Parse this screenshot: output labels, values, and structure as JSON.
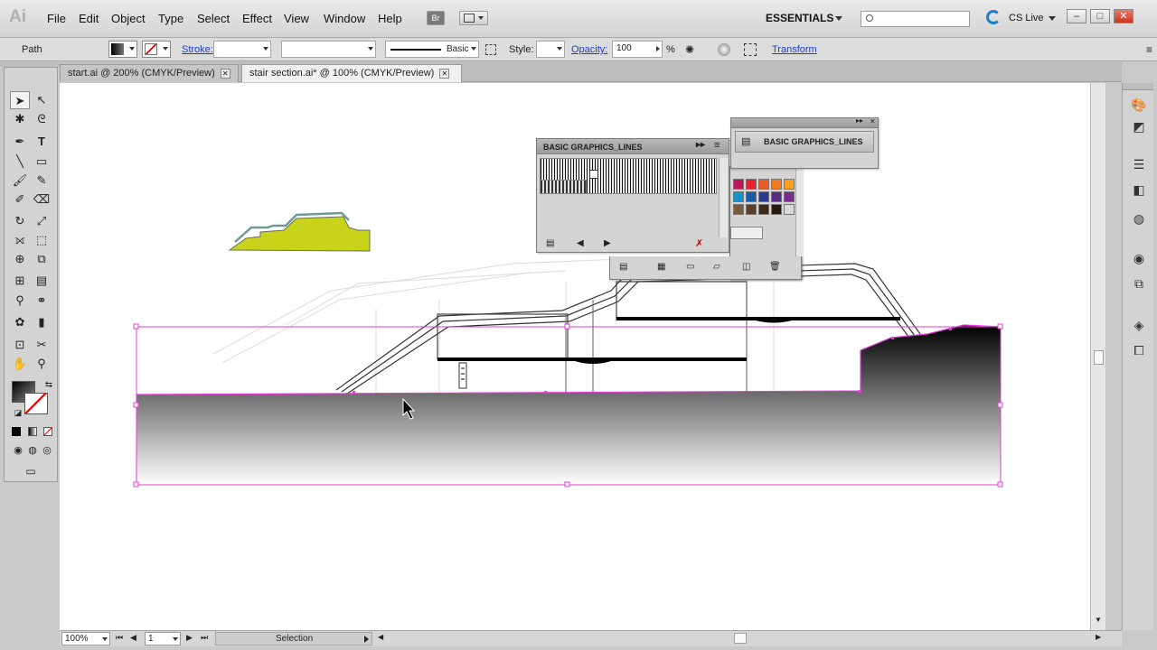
{
  "app": {
    "logo": "Ai",
    "menu": [
      "File",
      "Edit",
      "Object",
      "Type",
      "Select",
      "Effect",
      "View",
      "Window",
      "Help"
    ],
    "bridge_label": "Br",
    "workspace": "ESSENTIALS",
    "search_placeholder": "",
    "cs_live": "CS Live"
  },
  "control": {
    "selection_type": "Path",
    "stroke_label": "Stroke:",
    "stroke_value": "",
    "brush_label": "Basic",
    "style_label": "Style:",
    "opacity_label": "Opacity:",
    "opacity_value": "100",
    "opacity_unit": "%",
    "transform_label": "Transform"
  },
  "tabs": [
    {
      "label": "start.ai @ 200% (CMYK/Preview)",
      "active": false
    },
    {
      "label": "stair section.ai* @ 100% (CMYK/Preview)",
      "active": true
    }
  ],
  "panels": {
    "brush_library": {
      "title": "BASIC GRAPHICS_LINES"
    },
    "collapsed": {
      "title": "BASIC GRAPHICS_LINES"
    },
    "swatch_colors": [
      "#c0155a",
      "#e8232b",
      "#ef5a24",
      "#f47a20",
      "#f8a11c",
      "#1890c8",
      "#1b5aa4",
      "#2c3a8c",
      "#582d84",
      "#7b2b8c",
      "#7a5a3c",
      "#5c4128",
      "#3f2a1a",
      "#2a1a0e",
      "#d8d8d8"
    ]
  },
  "status": {
    "zoom": "100%",
    "page": "1",
    "tool": "Selection"
  },
  "colors": {
    "selection": "#e33cd6",
    "fill_green": "#c8d41a",
    "stroke_teal": "#6f9a9a"
  }
}
